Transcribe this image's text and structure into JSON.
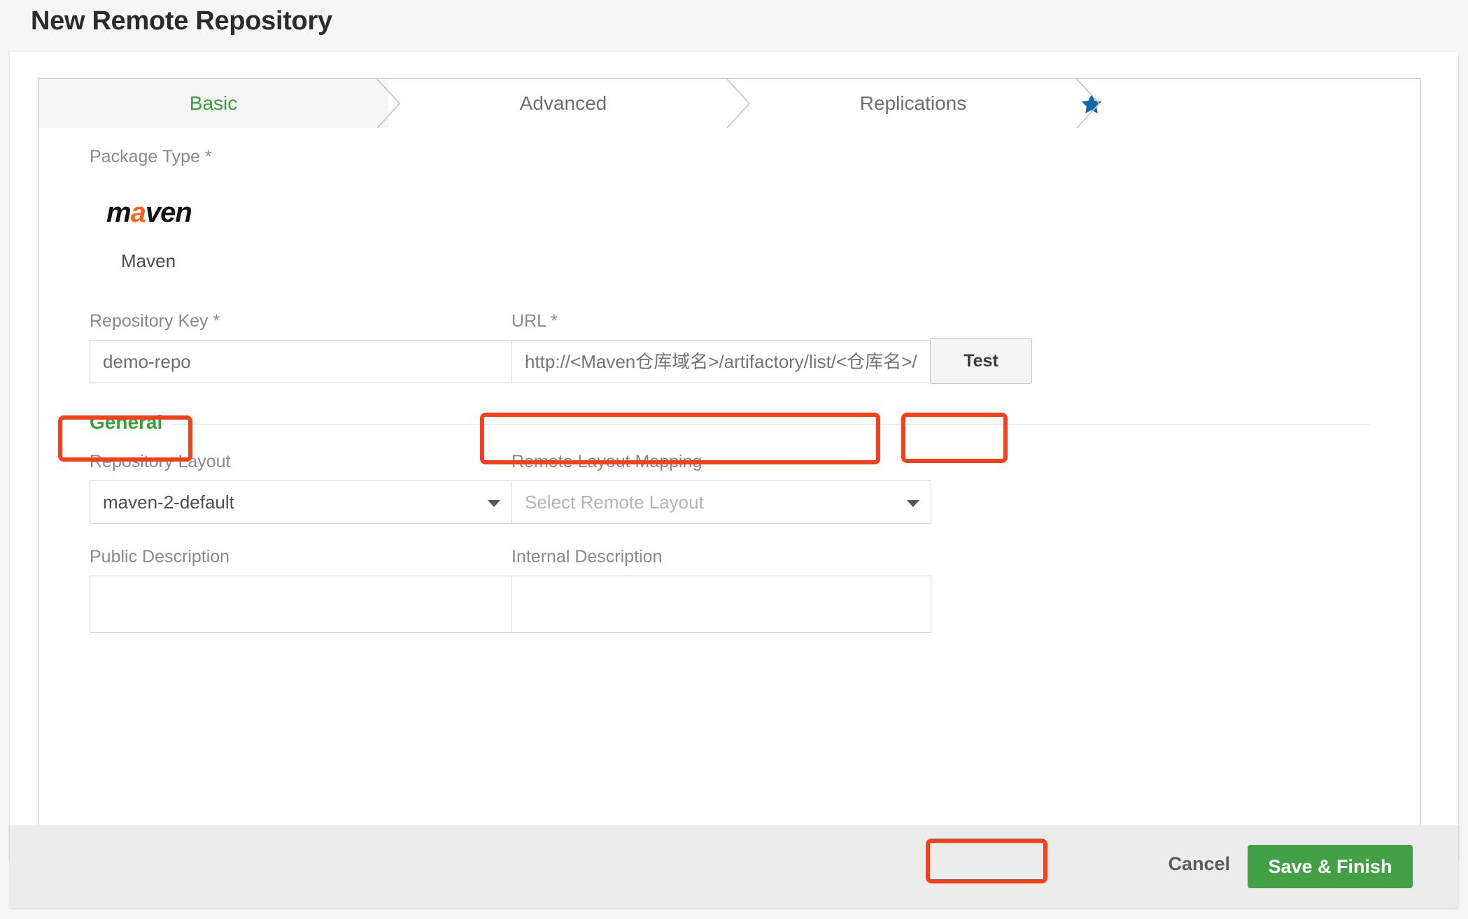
{
  "page": {
    "title": "New Remote Repository"
  },
  "tabs": [
    {
      "label": "Basic",
      "active": true
    },
    {
      "label": "Advanced",
      "active": false
    },
    {
      "label": "Replications",
      "active": false,
      "icon": "star-icon"
    }
  ],
  "form": {
    "package_type": {
      "label": "Package Type *",
      "logo_prefix": "m",
      "logo_accent": "a",
      "logo_suffix": "ven",
      "name": "Maven"
    },
    "repository_key": {
      "label": "Repository Key *",
      "value": "demo-repo",
      "placeholder": ""
    },
    "url": {
      "label": "URL *",
      "value": "",
      "placeholder": "http://<Maven仓库域名>/artifactory/list/<仓库名>/"
    },
    "test_button": "Test",
    "general": {
      "section_title": "General",
      "repository_layout": {
        "label": "Repository Layout",
        "value": "maven-2-default"
      },
      "remote_layout_mapping": {
        "label": "Remote Layout Mapping",
        "value": "Select Remote Layout",
        "is_placeholder": true
      },
      "public_description": {
        "label": "Public Description",
        "value": ""
      },
      "internal_description": {
        "label": "Internal Description",
        "value": ""
      }
    }
  },
  "footer": {
    "cancel_label": "Cancel",
    "save_label": "Save & Finish"
  },
  "colors": {
    "active_tab_text": "#3aa13a",
    "section_title": "#3aa13a",
    "star": "#1268a8",
    "maven_accent": "#f7651d",
    "save_button": "#43a047",
    "annotation": "#f5401b"
  }
}
